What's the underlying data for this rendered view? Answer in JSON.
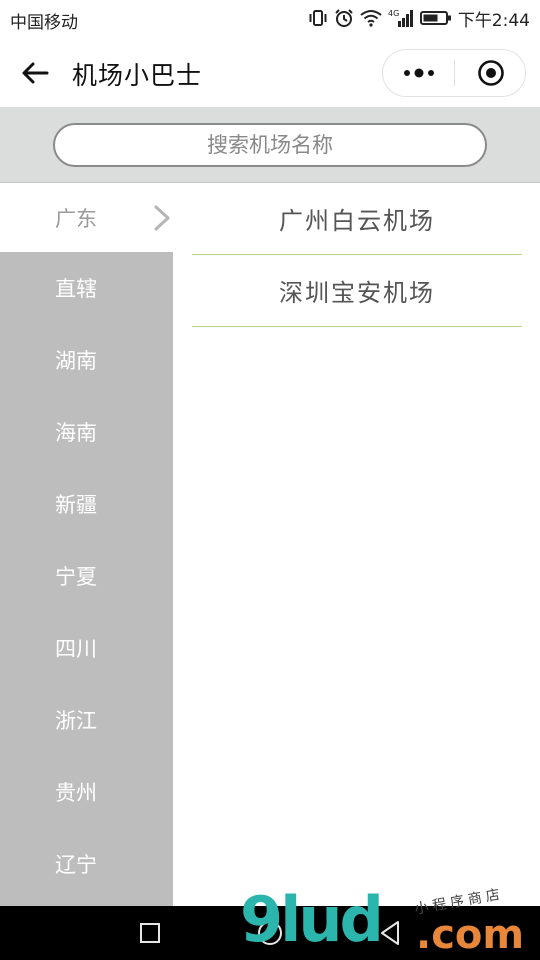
{
  "status_bar": {
    "carrier": "中国移动",
    "network": "4G",
    "time": "下午2:44"
  },
  "nav": {
    "title": "机场小巴士"
  },
  "search": {
    "placeholder": "搜索机场名称"
  },
  "sidebar": {
    "items": [
      {
        "label": "广东",
        "active": true
      },
      {
        "label": "直辖"
      },
      {
        "label": "湖南"
      },
      {
        "label": "海南"
      },
      {
        "label": "新疆"
      },
      {
        "label": "宁夏"
      },
      {
        "label": "四川"
      },
      {
        "label": "浙江"
      },
      {
        "label": "贵州"
      },
      {
        "label": "辽宁"
      }
    ]
  },
  "airports": [
    {
      "name": "广州白云机场"
    },
    {
      "name": "深圳宝安机场"
    }
  ],
  "watermark": {
    "logo": "9lud",
    "domain": ".com",
    "tagline": "小程序商店"
  },
  "colors": {
    "sidebar_bg": "#bdbdbd",
    "search_bg": "#dadddb",
    "divider_green": "#b6d38b"
  }
}
